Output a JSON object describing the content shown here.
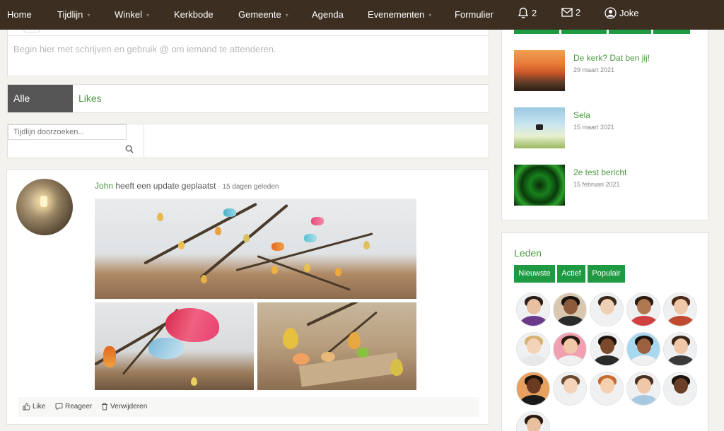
{
  "nav": {
    "items": [
      {
        "label": "Home",
        "dropdown": false
      },
      {
        "label": "Tijdlijn",
        "dropdown": true
      },
      {
        "label": "Winkel",
        "dropdown": true
      },
      {
        "label": "Kerkbode",
        "dropdown": false
      },
      {
        "label": "Gemeente",
        "dropdown": true
      },
      {
        "label": "Agenda",
        "dropdown": false
      },
      {
        "label": "Evenementen",
        "dropdown": true
      },
      {
        "label": "Formulier",
        "dropdown": false
      }
    ],
    "notifications_count": "2",
    "messages_count": "2",
    "user_name": "Joke",
    "caret": "▾"
  },
  "composer": {
    "placeholder": "Begin hier met schrijven en gebruik @ om iemand te attenderen."
  },
  "tabs": {
    "all_updates": "Alle Updates",
    "likes": "Likes"
  },
  "search": {
    "placeholder": "Tijdlijn doorzoeken..."
  },
  "post": {
    "author": "John",
    "action_text": "heeft een update geplaatst",
    "separator": " · ",
    "time": "15 dagen geleden",
    "actions": {
      "like": "Like",
      "reply": "Reageer",
      "delete": "Verwijderen"
    }
  },
  "articles": [
    {
      "title": "De kerk? Dat ben jij!",
      "date": "29 maart 2021",
      "thumb": "sunset-hills"
    },
    {
      "title": "Sela",
      "date": "15 maart 2021",
      "thumb": "video-sky"
    },
    {
      "title": "2e test bericht",
      "date": "15 februari 2021",
      "thumb": "green-tunnel"
    }
  ],
  "members": {
    "title": "Leden",
    "filters": [
      "Nieuwste",
      "Actief",
      "Populair"
    ],
    "active_filter": "Nieuwste"
  },
  "colors": {
    "nav_bg": "#3c2f22",
    "accent_green": "#4a9a3e",
    "button_green": "#1e9a43",
    "tab_active_bg": "#555555"
  }
}
